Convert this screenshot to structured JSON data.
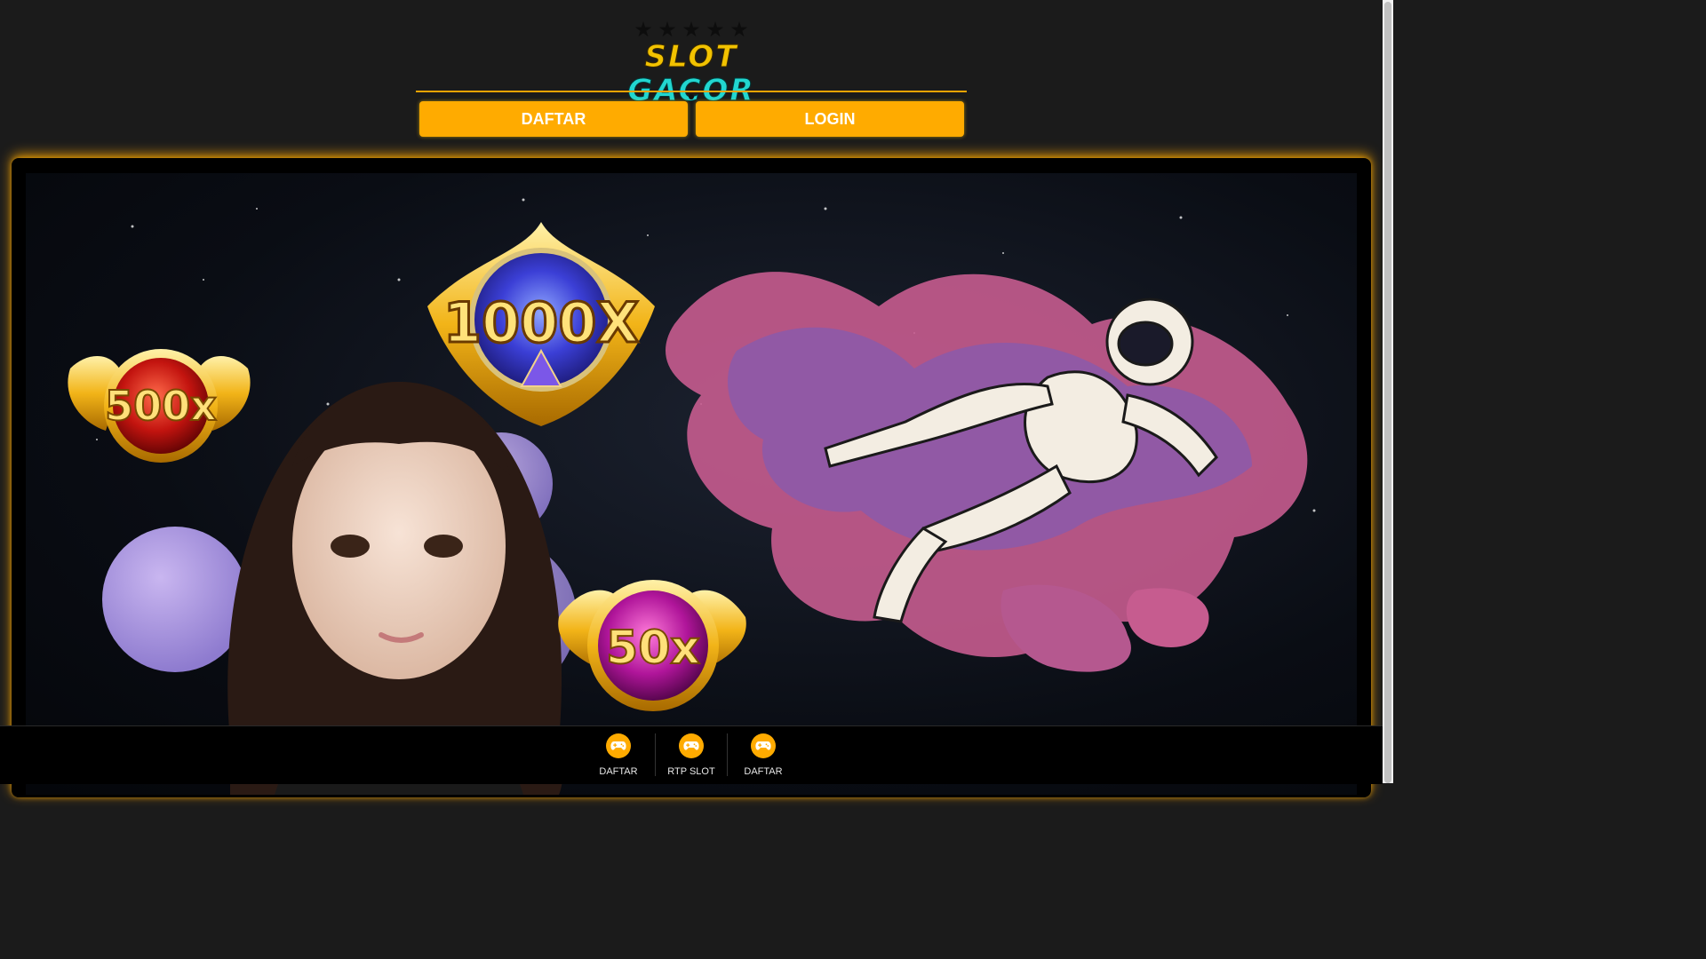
{
  "logo": {
    "word1": "SLOT",
    "word2": "GACOR",
    "stars": 5
  },
  "header": {
    "daftar_label": "DAFTAR",
    "login_label": "LOGIN"
  },
  "banner": {
    "badges": [
      "500x",
      "1000X",
      "50x"
    ]
  },
  "bottom_nav": {
    "items": [
      {
        "label": "DAFTAR",
        "icon": "gamepad-icon"
      },
      {
        "label": "RTP SLOT",
        "icon": "gamepad-icon"
      },
      {
        "label": "DAFTAR",
        "icon": "gamepad-icon"
      }
    ]
  },
  "colors": {
    "accent": "#ffab00",
    "background": "#1b1b1b",
    "logo_yellow": "#f2c200",
    "logo_cyan": "#22d6d0"
  }
}
